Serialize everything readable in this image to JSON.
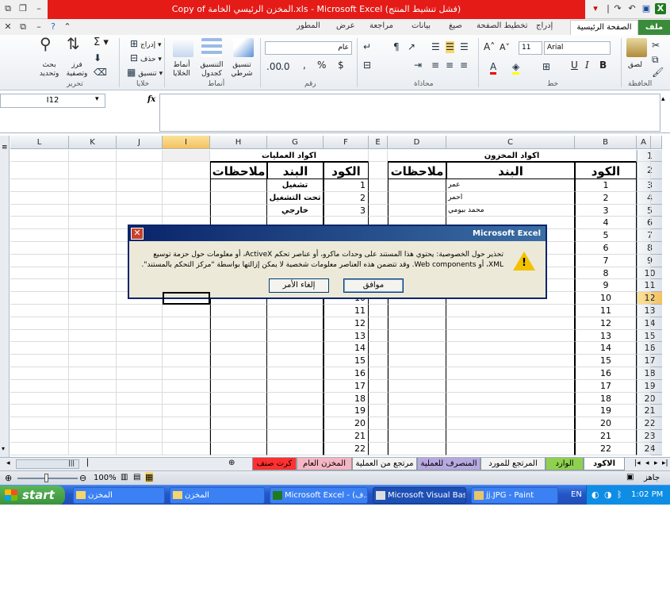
{
  "window": {
    "title": "Copy of المخزن الرئيسي الخامة.xls - Microsoft Excel (فشل تنشيط المنتج)"
  },
  "qat": {
    "undo": "↶",
    "redo": "↷"
  },
  "window_controls": {
    "min": "–",
    "max": "❐",
    "close": "✕"
  },
  "doc_controls": {
    "close": "✕",
    "restore": "⧉",
    "min": "–"
  },
  "tabs": [
    "ملف",
    "الصفحة الرئيسية",
    "إدراج",
    "تخطيط الصفحة",
    "صيغ",
    "بيانات",
    "مراجعة",
    "عرض",
    "المطور"
  ],
  "ribbon": {
    "groups": {
      "clipboard": "الحافظة",
      "font": "خط",
      "alignment": "محاذاة",
      "number": "رقم",
      "styles": "أنماط",
      "cells": "خلايا",
      "editing": "تحرير"
    },
    "paste_label": "لصق",
    "font_name": "Arial",
    "font_size": "11",
    "number_format": "عام",
    "cond_format": "تنسيق شرطي",
    "format_table": "التنسيق كجدول",
    "cell_styles": "أنماط الخلايا",
    "insert": "إدراج",
    "delete": "حذف",
    "format": "تنسيق",
    "sort_filter": "فرز وتصفية",
    "find_select": "بحث وتحديد",
    "bold": "B",
    "italic": "I",
    "underline": "U",
    "grow_font": "A˄",
    "shrink_font": "A˅",
    "currency": "$",
    "percent": "%",
    "comma": ","
  },
  "formula_bar": {
    "name_box": "I12",
    "fx": "fx",
    "formula": ""
  },
  "columns": [
    "A",
    "B",
    "C",
    "D",
    "E",
    "F",
    "G",
    "H",
    "I",
    "J",
    "K",
    "L"
  ],
  "rows": [
    "1",
    "2",
    "3",
    "4",
    "5",
    "6",
    "7",
    "8",
    "9",
    "10",
    "11",
    "12",
    "13",
    "14",
    "15",
    "16",
    "17",
    "18",
    "19",
    "20",
    "21",
    "22",
    "23",
    "24"
  ],
  "sheet": {
    "stock_title": "اكواد المخزون",
    "ops_title": "اكواد العمليات",
    "hdr_code": "الكود",
    "hdr_item": "البند",
    "hdr_notes": "ملاحظات",
    "stock_codes": [
      "1",
      "2",
      "3",
      "4",
      "5",
      "6",
      "7",
      "8",
      "9",
      "10",
      "11",
      "12",
      "13",
      "14",
      "15",
      "16",
      "17",
      "18",
      "19",
      "20",
      "21",
      "22"
    ],
    "stock_items": [
      "عمر",
      "احمر",
      "محمد بيومي"
    ],
    "ops_codes": [
      "1",
      "2",
      "3",
      "10",
      "11",
      "12",
      "13",
      "14",
      "15",
      "16",
      "17",
      "18",
      "19",
      "20",
      "21",
      "22"
    ],
    "ops_items": [
      "تشغيل",
      "تحت التشغيل",
      "خارجي"
    ]
  },
  "dialog": {
    "title": "Microsoft Excel",
    "message": "تحذير حول الخصوصية: يحتوي هذا المستند على وحدات ماكرو، أو عناصر تحكم ActiveX، أو معلومات حول حزمة توسيع XML، أو Web components. وقد تتضمن هذه العناصر معلومات شخصية لا يمكن إزالتها بواسطة \"مركز التحكم بالمستند\".",
    "ok": "موافق",
    "cancel": "إلغاء الأمر"
  },
  "sheet_tabs": [
    {
      "label": "الاكود",
      "color": "#ffffff",
      "active": true
    },
    {
      "label": "الوارد",
      "color": "#8fd14f"
    },
    {
      "label": "المرتجع للمورد",
      "color": "#f2f2f2"
    },
    {
      "label": "المنصرف للعملية",
      "color": "#b7a9e0"
    },
    {
      "label": "مرتجع من العملية",
      "color": "#f2f2f2"
    },
    {
      "label": "المخزن العام",
      "color": "#f4b6c2"
    },
    {
      "label": "كرت صنف",
      "color": "#ff3030"
    }
  ],
  "status": {
    "ready": "جاهز",
    "zoom": "100%"
  },
  "taskbar": {
    "start": "start",
    "items": [
      "المخزن",
      "المخزن",
      "Microsoft Excel - (ف...",
      "Microsoft Visual Basi...",
      "jj.JPG - Paint"
    ],
    "lang": "EN",
    "time": "1:02 PM"
  }
}
